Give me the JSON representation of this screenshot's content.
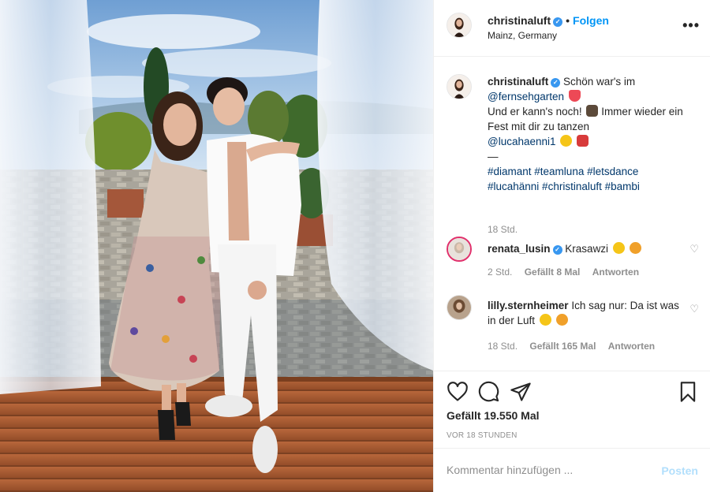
{
  "photo": {
    "alt_subject": "couple-photo"
  },
  "header": {
    "username": "christinaluft",
    "separator": "•",
    "follow_label": "Folgen",
    "location": "Mainz, Germany",
    "more_label": "•••"
  },
  "caption": {
    "username": "christinaluft",
    "text_1": "Schön war's im",
    "tag_1": "@fernsehgarten",
    "text_2": "Und er kann's noch!",
    "text_3": "Immer wieder ein Fest mit dir zu tanzen",
    "tag_2": "@lucahaenni1",
    "dash": "—",
    "hashtags_1": "#diamant #teamluna #letsdance",
    "hashtags_2": "#lucahänni #christinaluft #bambi",
    "time": "18 Std."
  },
  "comments": [
    {
      "username": "renata_lusin",
      "text": "Krasawzi",
      "time": "2 Std.",
      "likes": "Gefällt 8 Mal",
      "reply": "Antworten"
    },
    {
      "username": "lilly.sternheimer",
      "text": "Ich sag nur: Da ist was in der Luft",
      "time": "18 Std.",
      "likes": "Gefällt 165 Mal",
      "reply": "Antworten"
    }
  ],
  "actions": {
    "likes": "Gefällt 19.550 Mal",
    "ago": "VOR 18 STUNDEN",
    "icons": [
      "heart-icon",
      "comment-icon",
      "share-icon",
      "bookmark-icon"
    ]
  },
  "add_comment": {
    "placeholder": "Kommentar hinzufügen ...",
    "post_label": "Posten"
  },
  "colors": {
    "link": "#0095f6",
    "mention": "#00376b",
    "muted": "#8e8e8e",
    "verified": "#3897f0"
  }
}
